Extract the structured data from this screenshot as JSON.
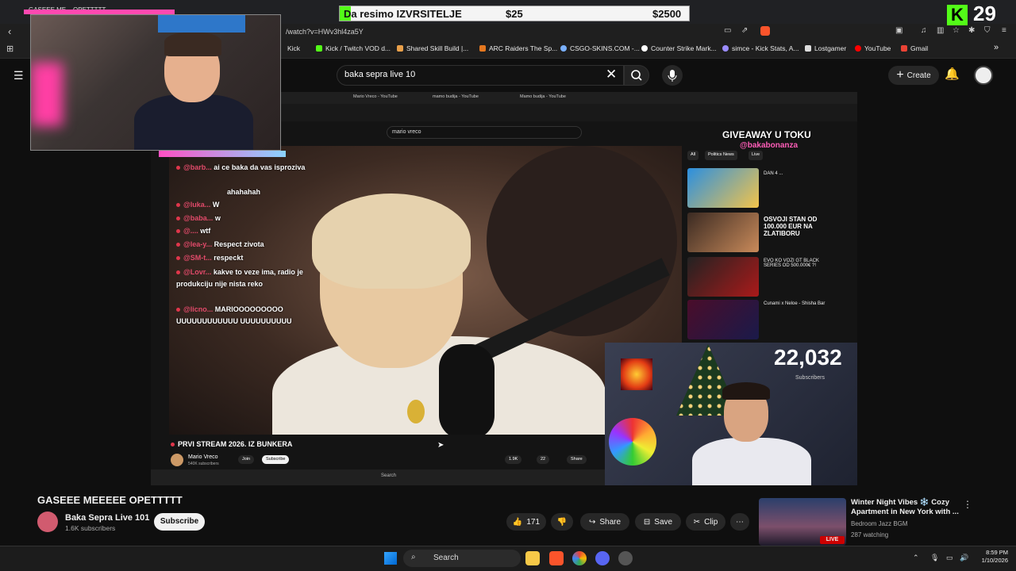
{
  "browser": {
    "tab_title": "GASEEE ME... OPETTTTT",
    "url": "/watch?v=HWv3hl4za5Y",
    "bookmarks": [
      "Kick",
      "Kick / Twitch VOD d...",
      "Shared Skill Build |...",
      "ARC Raiders The Sp...",
      "CSGO-SKINS.COM -...",
      "Counter Strike Mark...",
      "simce - Kick Stats, A...",
      "Lostgamer",
      "YouTube",
      "Gmail"
    ],
    "more": "»"
  },
  "overlay": {
    "banner_text": "Da resimo IZVRSITELJE",
    "banner_amount": "$25",
    "banner_goal": "$2500",
    "kick_logo": "K",
    "kick_count": "29"
  },
  "header": {
    "search_value": "baka sepra live 10",
    "create_label": "Create"
  },
  "inner_browser": {
    "tabs": [
      "Mario Vreco - YouTube",
      "mamo budija - YouTube",
      "Mamo budija - YouTube"
    ],
    "search_value": "mario vreco",
    "chips": [
      "All",
      "Politics News",
      "Live"
    ],
    "giveaway": "GIVEAWAY U TOKU",
    "giveaway_handle": "@bakabonanza",
    "recommendations": [
      {
        "title": "DAN 4 ..."
      },
      {
        "title": "OSVOJI STAN OD 100.000 EUR NA ZLATIBORU"
      },
      {
        "title": "EVO KO VOZI GT BLACK SERIES OD 500.000€ ?!"
      },
      {
        "title": "Cunami x Neloe - Shisha Bar"
      }
    ],
    "sub_count": "22,032",
    "sub_label": "Subscribers",
    "video_title": "PRVI STREAM 2026. IZ BUNKERA",
    "channel": "Mario Vreco",
    "channel_subs": "540K subscribers",
    "join": "Join",
    "subscribe": "Subscribe",
    "likes": "1.9K",
    "comments": "22",
    "share": "Share",
    "taskbar_search": "Search"
  },
  "chat": [
    {
      "user": "@barb...",
      "msg": "ai ce baka da vas isproziva"
    },
    {
      "user": "",
      "msg": "ahahahah"
    },
    {
      "user": "@luka...",
      "msg": "W"
    },
    {
      "user": "@baba...",
      "msg": "w"
    },
    {
      "user": "@....",
      "msg": "wtf"
    },
    {
      "user": "@lea-y...",
      "msg": "Respect zivota"
    },
    {
      "user": "@SM-t...",
      "msg": "respeckt"
    },
    {
      "user": "@Lovr...",
      "msg": "kakve to veze ima, radio je produkciju nije nista reko"
    },
    {
      "user": "@licno...",
      "msg": "MARIOOOOOOOOO UUUUUUUUUUUU UUUUUUUUUU"
    }
  ],
  "video": {
    "title": "GASEEE MEEEEE OPETTTTT",
    "channel": "Baka Sepra Live 101",
    "subscribers": "1.6K subscribers",
    "subscribe_label": "Subscribe",
    "likes": "171",
    "share": "Share",
    "save": "Save",
    "clip": "Clip"
  },
  "sidebar_video": {
    "title": "Winter Night Vibes ❄️ Cozy Apartment in New York with ...",
    "channel": "Bedroom Jazz BGM",
    "watching": "287 watching",
    "live": "LIVE"
  },
  "taskbar": {
    "search": "Search",
    "time": "8:59 PM",
    "date": "1/10/2026"
  }
}
